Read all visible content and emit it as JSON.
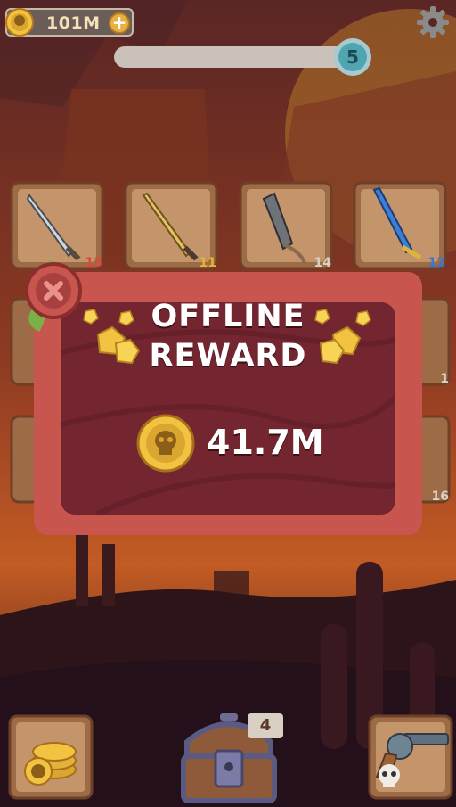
{
  "header": {
    "coins": "101M",
    "plus_label": "+"
  },
  "level": {
    "number": "5",
    "progress_fraction": 0.0
  },
  "grid": {
    "tiles": [
      {
        "level": "13",
        "level_color": "#e0463b",
        "weapon": "steel-sword-icon"
      },
      {
        "level": "11",
        "level_color": "#e5b433",
        "weapon": "golden-sword-icon"
      },
      {
        "level": "14",
        "level_color": "#d9d1c6",
        "weapon": "dark-axe-icon"
      },
      {
        "level": "12",
        "level_color": "#3a74d4",
        "weapon": "blue-sword-icon"
      }
    ],
    "partial_levels": [
      "1",
      "16"
    ]
  },
  "popup": {
    "title_line1": "OFFLINE",
    "title_line2": "REWARD",
    "amount": "41.7M"
  },
  "bottom": {
    "chest_count": "4"
  },
  "colors": {
    "popup_outer": "#c9554f",
    "popup_inner": "#732530",
    "gold": "#f2c341"
  }
}
